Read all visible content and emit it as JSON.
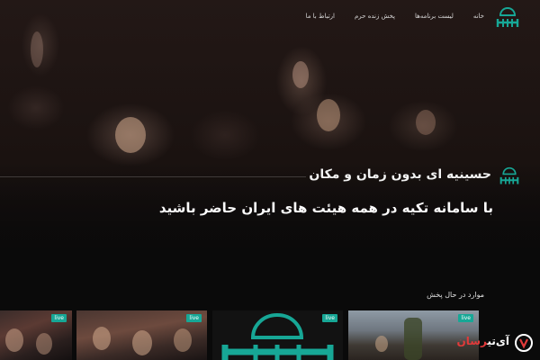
{
  "nav": {
    "links": [
      "خانه",
      "لیست برنامه‌ها",
      "پخش زنده حرم",
      "ارتباط با ما"
    ]
  },
  "hero": {
    "title": "حسینیه ای بدون زمان و مکان",
    "subtitle": "با سامانه تکیه در همه هیئت های ایران حاضر باشید"
  },
  "live_section": {
    "title": "موارد در حال پخش",
    "cards": [
      {
        "badge": "live"
      },
      {
        "badge": "live"
      },
      {
        "badge": "live"
      },
      {
        "badge": "live"
      }
    ]
  },
  "watermark": {
    "text_main": "آی‌تی",
    "text_accent": "رسان"
  },
  "colors": {
    "accent": "#17a796",
    "background": "#0b0b0b"
  },
  "icons": {
    "brand": "mosque-logo-icon",
    "watermark": "itresan-logo-icon"
  }
}
